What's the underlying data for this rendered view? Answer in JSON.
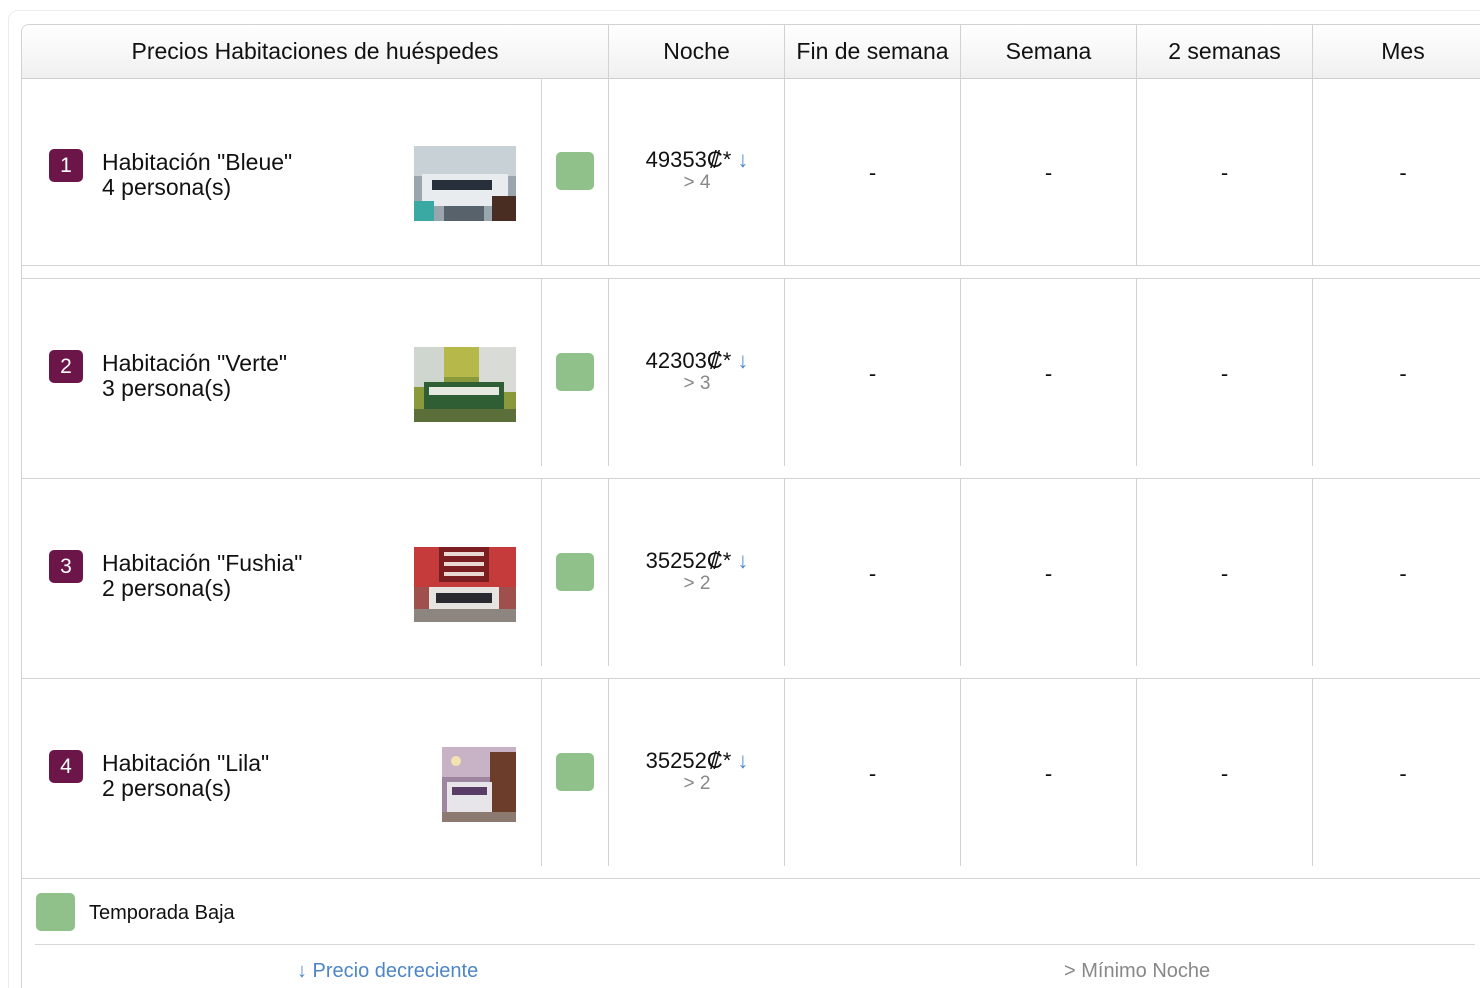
{
  "table": {
    "title": "Precios Habitaciones de huéspedes",
    "columns": [
      "Noche",
      "Fin de semana",
      "Semana",
      "2 semanas",
      "Mes"
    ]
  },
  "rooms": [
    {
      "num": "1",
      "name": "Habitación \"Bleue\"",
      "capacity": "4 persona(s)",
      "night_price": "49353₡*",
      "arrow": "↓",
      "min_night": "> 4",
      "weekend": "-",
      "week": "-",
      "two_weeks": "-",
      "month": "-",
      "photo": "blue-room-photo"
    },
    {
      "num": "2",
      "name": "Habitación \"Verte\"",
      "capacity": "3 persona(s)",
      "night_price": "42303₡*",
      "arrow": "↓",
      "min_night": "> 3",
      "weekend": "-",
      "week": "-",
      "two_weeks": "-",
      "month": "-",
      "photo": "green-room-photo"
    },
    {
      "num": "3",
      "name": "Habitación \"Fushia\"",
      "capacity": "2 persona(s)",
      "night_price": "35252₡*",
      "arrow": "↓",
      "min_night": "> 2",
      "weekend": "-",
      "week": "-",
      "two_weeks": "-",
      "month": "-",
      "photo": "fuchsia-room-photo"
    },
    {
      "num": "4",
      "name": "Habitación \"Lila\"",
      "capacity": "2 persona(s)",
      "night_price": "35252₡*",
      "arrow": "↓",
      "min_night": "> 2",
      "weekend": "-",
      "week": "-",
      "two_weeks": "-",
      "month": "-",
      "photo": "lilac-room-photo"
    }
  ],
  "legend": {
    "season_label": "Temporada Baja",
    "season_color": "#90c18a",
    "arrow_label": "↓ Precio decreciente",
    "min_label": "> Mínimo Noche"
  },
  "colors": {
    "badge": "#6b1548",
    "arrow": "#4d86c6",
    "muted": "#888888"
  }
}
